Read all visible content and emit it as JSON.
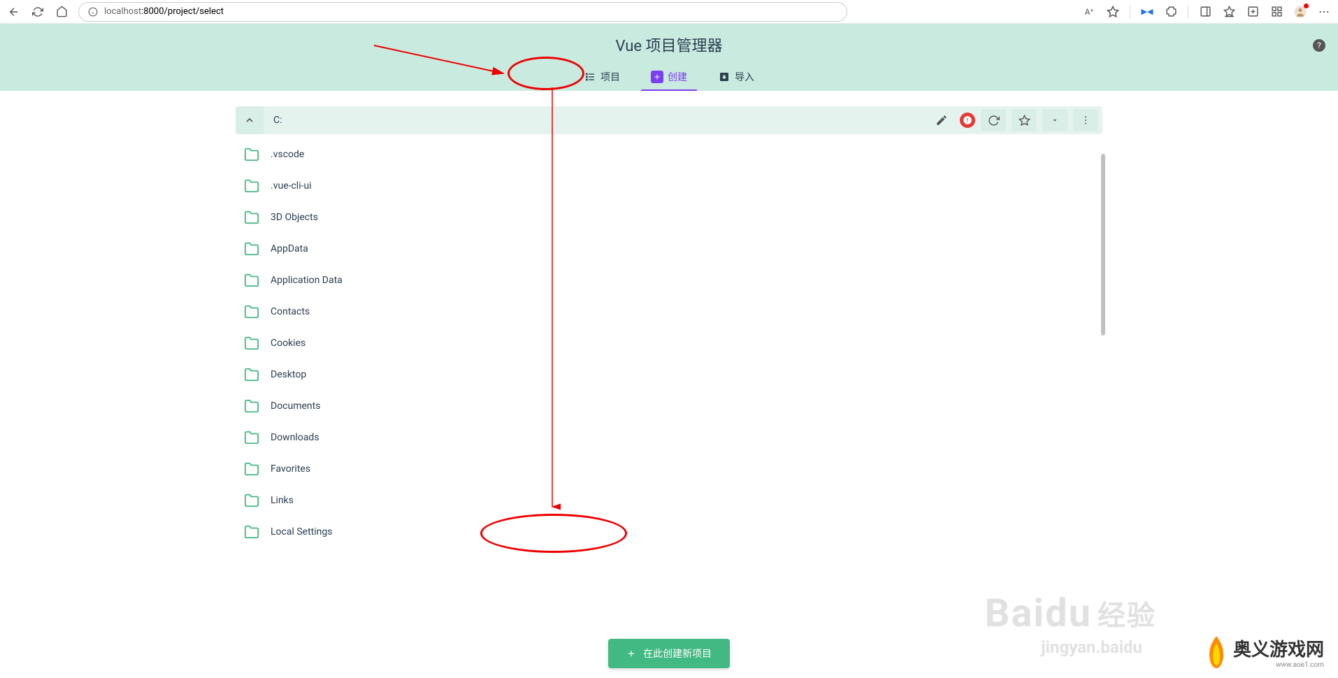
{
  "browser": {
    "url_host": "localhost",
    "url_path": ":8000/project/select",
    "aa_icon": "A⁺"
  },
  "header": {
    "title": "Vue 项目管理器",
    "help": "?"
  },
  "tabs": [
    {
      "label": "项目",
      "icon": "list",
      "active": false
    },
    {
      "label": "创建",
      "icon": "add",
      "active": true
    },
    {
      "label": "导入",
      "icon": "import",
      "active": false
    }
  ],
  "path": {
    "current": "C:"
  },
  "folders": [
    {
      "name": ".vscode"
    },
    {
      "name": ".vue-cli-ui"
    },
    {
      "name": "3D Objects"
    },
    {
      "name": "AppData"
    },
    {
      "name": "Application Data"
    },
    {
      "name": "Contacts"
    },
    {
      "name": "Cookies"
    },
    {
      "name": "Desktop"
    },
    {
      "name": "Documents"
    },
    {
      "name": "Downloads"
    },
    {
      "name": "Favorites"
    },
    {
      "name": "Links"
    },
    {
      "name": "Local Settings"
    }
  ],
  "create_button": "在此创建新项目",
  "watermarks": {
    "baidu": "Baidu",
    "baidu_sub": "经验",
    "baidu_url": "jingyan.baidu",
    "site": "奥义游戏网",
    "site_url": "www.aoe1.com"
  }
}
